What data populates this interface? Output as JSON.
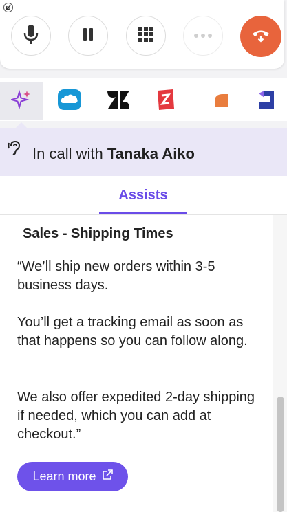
{
  "controls": {
    "minimize_icon": "minimize-icon",
    "mute_icon": "microphone-icon",
    "hold_icon": "pause-icon",
    "keypad_icon": "dialpad-icon",
    "more_icon": "more-icon",
    "end_call_icon": "hangup-icon",
    "end_call_color": "#e8643c"
  },
  "apps": [
    {
      "name": "assist",
      "icon": "sparkle-icon",
      "active": true
    },
    {
      "name": "salesforce",
      "icon": "salesforce-cloud-icon"
    },
    {
      "name": "zendesk",
      "icon": "zendesk-icon"
    },
    {
      "name": "zoho",
      "icon": "zoho-z-icon"
    },
    {
      "name": "app-orange",
      "icon": "orange-shape-icon"
    },
    {
      "name": "app-blue",
      "icon": "blue-arrow-icon"
    }
  ],
  "call": {
    "prefix": "In call with ",
    "contact_name": "Tanaka Aiko"
  },
  "tabs": [
    {
      "label": "Assists",
      "active": true
    }
  ],
  "assist": {
    "title": "Sales - Shipping Times",
    "paragraphs": [
      "“We’ll ship new orders within 3-5 business days.",
      "You’ll get a tracking email as soon as that happens so you can follow along.",
      "We also offer expedited 2-day shipping if needed, which you can add at checkout.”"
    ],
    "learn_more_label": "Learn more"
  },
  "colors": {
    "accent": "#6a4ce8",
    "banner": "#eae7f7"
  }
}
